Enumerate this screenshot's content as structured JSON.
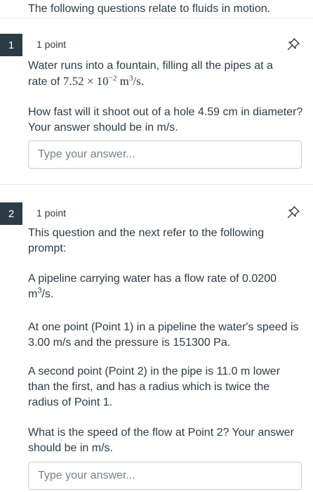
{
  "intro": "The following questions relate to fluids in motion.",
  "questions": [
    {
      "number": "1",
      "points": "1 point",
      "line1": "Water runs into a fountain, filling all the pipes at a",
      "rate_prefix": "rate of ",
      "rate_math": "7.52 × 10",
      "rate_exp": "−2",
      "rate_unit": " m",
      "rate_unit_exp": "3",
      "rate_suffix": "/s.",
      "para2": "How fast will it shoot out of a hole 4.59 cm in diameter? Your answer should be in m/s.",
      "placeholder": "Type your answer..."
    },
    {
      "number": "2",
      "points": "1 point",
      "para1": "This question and the next refer to the following prompt:",
      "para2_prefix": "A pipeline carrying water has a flow rate of 0.0200 m",
      "para2_exp": "3",
      "para2_suffix": "/s.",
      "para3": "At one point (Point 1) in a pipeline the water's speed is 3.00 m/s and the pressure is 151300 Pa.",
      "para4": "A second point (Point 2) in the pipe is 11.0 m lower than the first, and has a radius which is twice the radius of Point 1.",
      "para5": "What is the speed of the flow at Point 2? Your answer should be in m/s.",
      "placeholder": "Type your answer..."
    }
  ],
  "icons": {
    "pin": "pin-icon"
  }
}
